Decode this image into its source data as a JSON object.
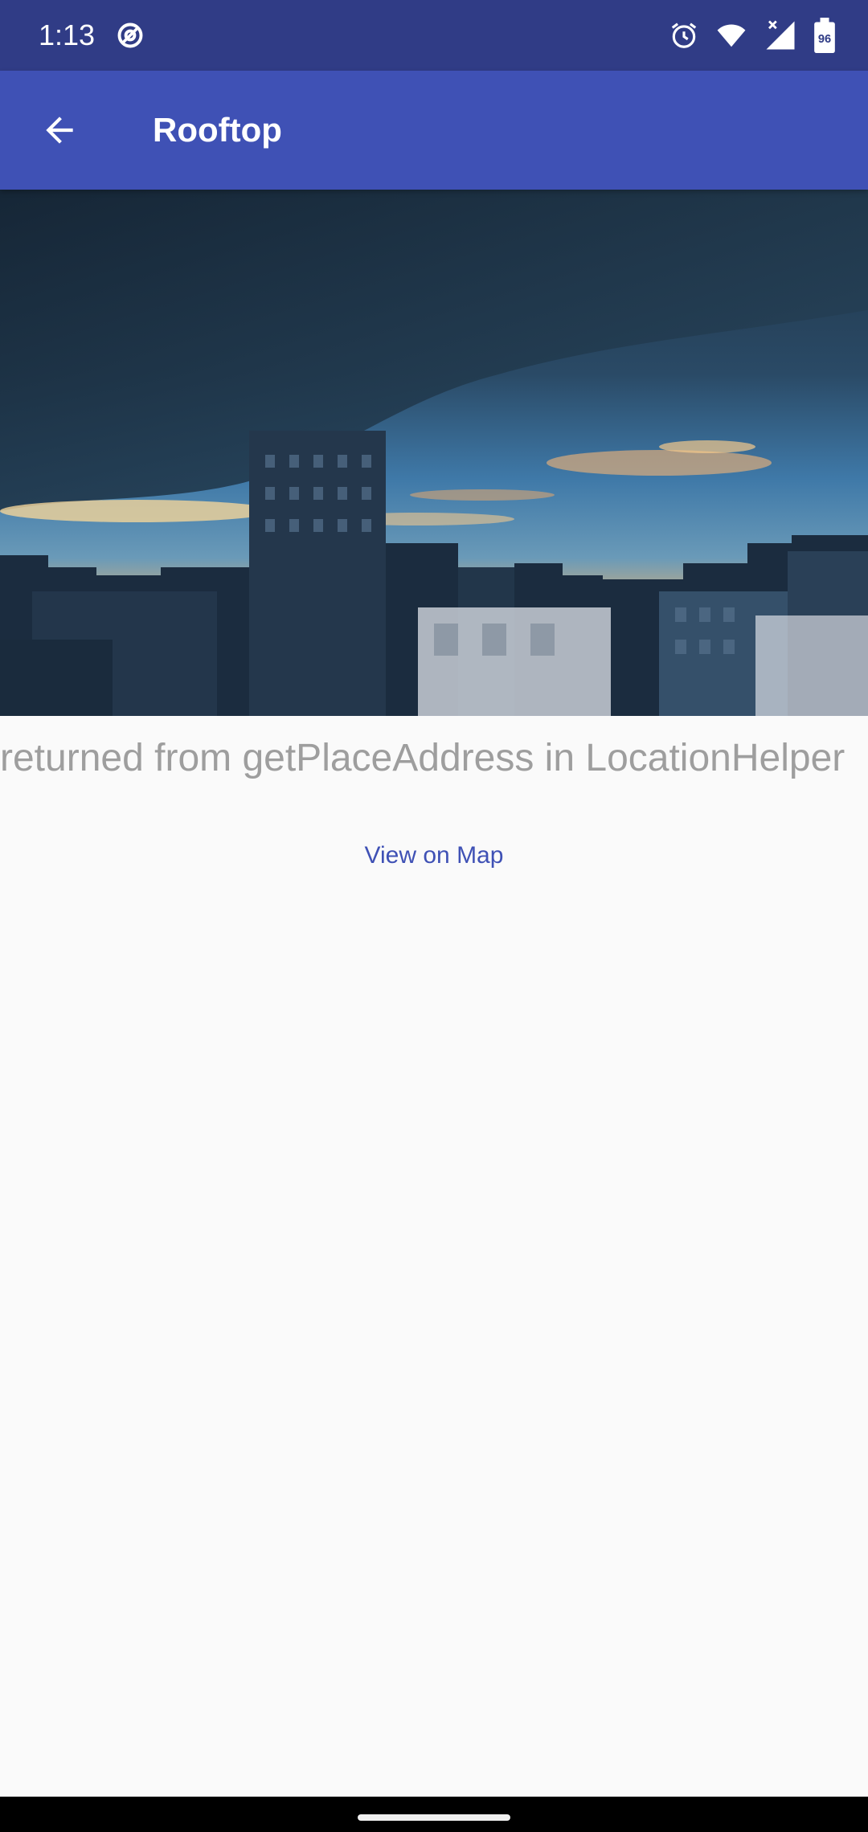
{
  "status_bar": {
    "time": "1:13",
    "battery_level": "96",
    "icons": [
      "at-sign-icon",
      "alarm-icon",
      "wifi-icon",
      "signal-icon",
      "battery-icon"
    ]
  },
  "app_bar": {
    "title": "Rooftop",
    "back_icon": "arrow-back-icon",
    "color": "#3f51b5"
  },
  "place": {
    "address_text": "returned from getPlaceAddress in LocationHelper",
    "map_link_label": "View on Map"
  },
  "colors": {
    "primary": "#3f51b5",
    "primary_dark": "#303c86",
    "address_text": "#9e9e9e"
  }
}
